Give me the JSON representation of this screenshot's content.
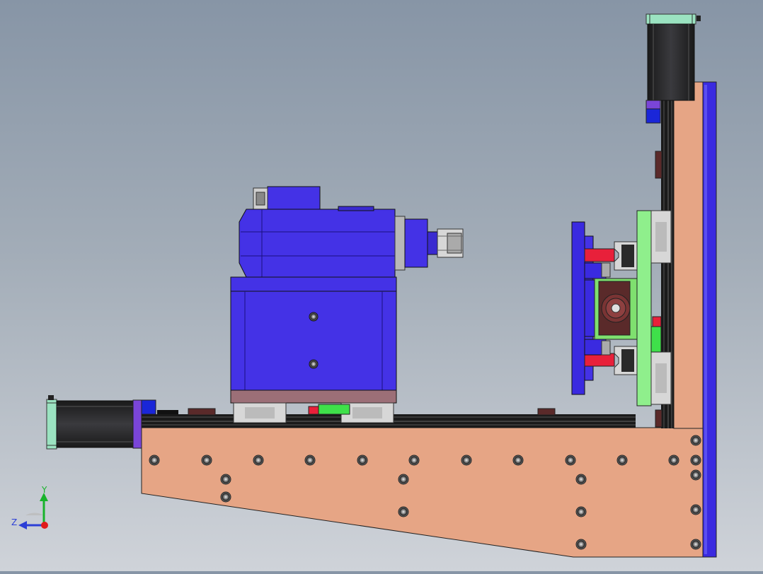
{
  "viewport": {
    "background_top": "#8795a6",
    "background_bottom": "#cfd3d9"
  },
  "triad": {
    "y_label": "Y",
    "z_label": "Z",
    "y_color": "#18b32b",
    "z_color": "#2c3fd6",
    "x_color": "#e01b1b"
  },
  "palette": {
    "base_plate": "#e6a585",
    "motor_blue": "#4432e6",
    "rail_black": "#1a1a1a",
    "stepper_body": "#2b2b2e",
    "stepper_cap": "#9be3c1",
    "green_carriage": "#8fef8c",
    "red_block": "#e8203a",
    "dark_maroon": "#5a2a2a",
    "frame_blue": "#3a2ae0"
  }
}
